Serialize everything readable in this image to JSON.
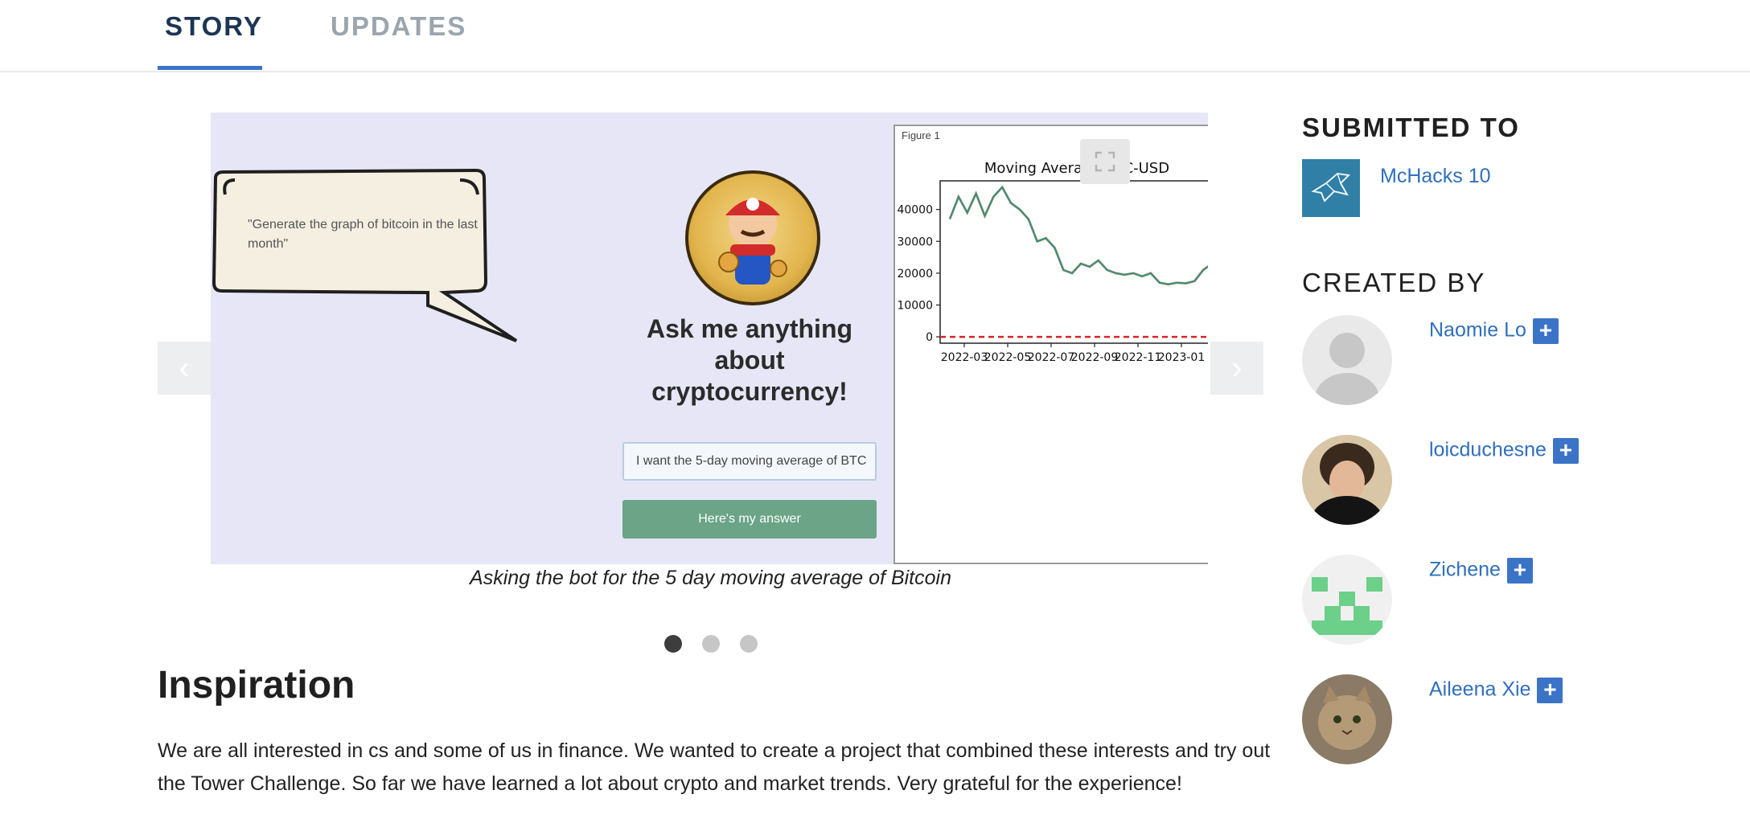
{
  "tabs": [
    {
      "label": "STORY",
      "active": true
    },
    {
      "label": "UPDATES",
      "active": false
    }
  ],
  "carousel": {
    "prev_icon": "chevron-left-icon",
    "next_icon": "chevron-right-icon",
    "expand_icon": "expand-icon",
    "caption": "Asking the bot for the 5 day moving average of Bitcoin",
    "slide_count": 3,
    "active_slide": 1,
    "slide": {
      "bubble_text": "\"Generate the graph of bitcoin in the last month\"",
      "ask_title": "Ask me anything about cryptocurrency!",
      "input_value": "I want the 5-day moving average of BTC",
      "answer_button": "Here's my answer",
      "figure_window_title": "Figure 1"
    }
  },
  "chart_data": {
    "type": "line",
    "title": "Moving Average BTC-USD",
    "xlabel": "",
    "ylabel": "",
    "x_ticks": [
      "2022-03",
      "2022-05",
      "2022-07",
      "2022-09",
      "2022-11",
      "2023-01"
    ],
    "y_ticks": [
      0,
      10000,
      20000,
      30000,
      40000
    ],
    "ylim": [
      -2000,
      49000
    ],
    "series": [
      {
        "values": [
          37000,
          44000,
          39000,
          45000,
          38000,
          44000,
          47000,
          42000,
          40000,
          37000,
          30000,
          31000,
          28000,
          21000,
          20000,
          23000,
          22000,
          24000,
          21000,
          20000,
          19500,
          20000,
          19000,
          20000,
          17000,
          16500,
          17000,
          16800,
          17500,
          21000,
          23000
        ]
      }
    ],
    "reference_line": 0,
    "colors": {
      "line": "#2f8b9b",
      "reference": "#d62728"
    }
  },
  "section": {
    "heading": "Inspiration",
    "paragraph": "We are all interested in cs and some of us in finance. We wanted to create a project that combined these interests and try out the Tower Challenge. So far we have learned a lot about crypto and market trends. Very grateful for the experience!"
  },
  "sidebar": {
    "submitted_heading": "SUBMITTED TO",
    "hackathon": "McHacks 10",
    "created_heading": "CREATED BY",
    "members": [
      {
        "name": "Naomie Lo"
      },
      {
        "name": "loicduchesne"
      },
      {
        "name": "Zichene"
      },
      {
        "name": "Aileena Xie"
      }
    ],
    "follow_label": "+"
  },
  "colors": {
    "accent": "#3b73c7",
    "link": "#2f6fbd",
    "tab_active": "#1c3552",
    "tab_inactive": "#9aa5ad"
  }
}
